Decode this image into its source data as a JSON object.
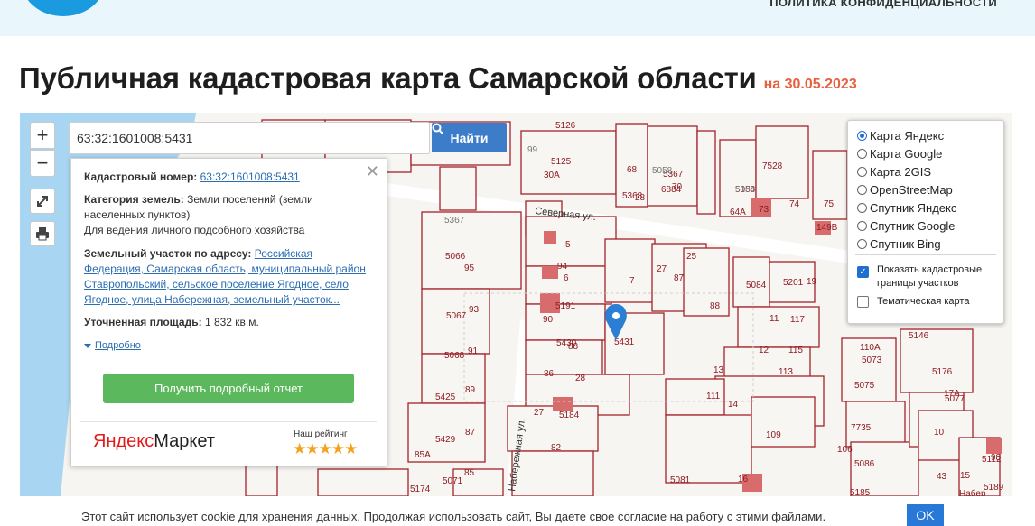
{
  "header": {
    "privacy_link": "ПОЛИТИКА КОНФИДЕНЦИАЛЬНОСТИ",
    "title": "Публичная кадастровая карта Самарской области",
    "date": "на 30.05.2023"
  },
  "search": {
    "value": "63:32:1601008:5431",
    "button": "Найти"
  },
  "map_controls": {
    "zoom_in": "+",
    "zoom_out": "−"
  },
  "info": {
    "cadastral_label": "Кадастровый номер:",
    "cadastral_number": "63:32:1601008:5431",
    "category_label": "Категория земель:",
    "category_value": "Земли поселений (земли населенных пунктов)",
    "usage": "Для ведения личного подсобного хозяйства",
    "address_label": "Земельный участок по адресу:",
    "address_value": "Российская Федерация, Самарская область, муниципальный район Ставропольский, сельское поселение Ягодное, село Ягодное, улица Набережная, земельный участок...",
    "area_label": "Уточненная площадь:",
    "area_value": "1 832 кв.м.",
    "more": "Подробно",
    "report_button": "Получить подробный отчет",
    "ym_logo_a": "Яндекс",
    "ym_logo_b": "Маркет",
    "rating_label": "Наш рейтинг",
    "stars": "★★★★★"
  },
  "layers": {
    "options": [
      "Карта Яндекс",
      "Карта Google",
      "Карта 2GIS",
      "OpenStreetMap",
      "Спутник Яндекс",
      "Спутник Google",
      "Спутник Bing"
    ],
    "selected": "Карта Яндекс",
    "show_borders": "Показать кадастровые границы участков",
    "show_borders_checked": true,
    "thematic": "Тематическая карта",
    "thematic_checked": false
  },
  "map": {
    "streets": [
      "Северная ул.",
      "Набережная ул."
    ],
    "plot_numbers": [
      "5126",
      "5125",
      "30А",
      "68",
      "5367",
      "6884",
      "5368",
      "28",
      "70",
      "5058",
      "64А",
      "7528",
      "73",
      "74",
      "75",
      "149В",
      "5",
      "94",
      "6",
      "27",
      "25",
      "87",
      "5084",
      "5201",
      "19",
      "7",
      "5191",
      "88",
      "90",
      "11",
      "117",
      "5430",
      "5431",
      "12",
      "115",
      "13",
      "113",
      "5066",
      "95",
      "5067",
      "93",
      "5068",
      "91",
      "5425",
      "89",
      "5429",
      "87",
      "85А",
      "5174",
      "5071",
      "85",
      "27",
      "5184",
      "28",
      "86",
      "88",
      "111",
      "14",
      "82",
      "109",
      "5081",
      "16",
      "Набер",
      "5146",
      "110А",
      "5073",
      "5075",
      "5176",
      "5077",
      "17А",
      "7735",
      "10",
      "106",
      "5086",
      "43",
      "15",
      "5112",
      "5185",
      "5189",
      "98",
      "99",
      "5367",
      "5058",
      "5184"
    ],
    "selected_plot": "5431"
  },
  "cookie": {
    "text": "Этот сайт использует cookie для хранения данных. Продолжая использовать сайт, Вы даете свое согласие на работу с этими файлами.",
    "ok": "OK"
  },
  "colors": {
    "accent": "#e8603d",
    "button_blue": "#3d7cc9",
    "report_green": "#5cb85c",
    "plot_border": "#a3232b"
  }
}
